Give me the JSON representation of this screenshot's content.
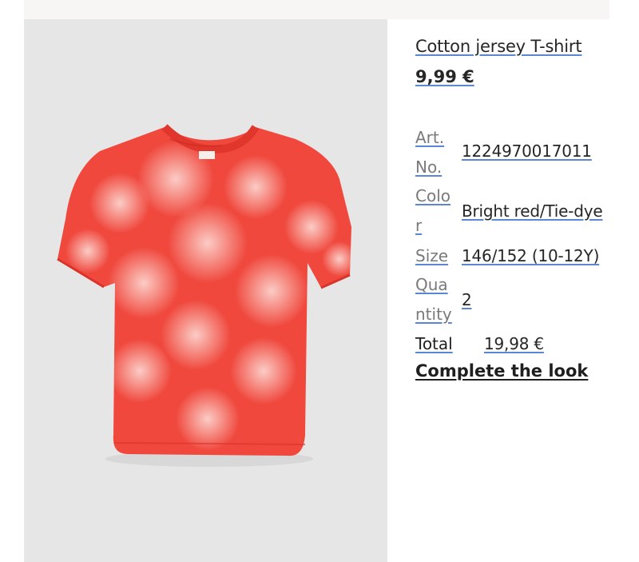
{
  "product": {
    "image_icon": "tie-dye-tshirt",
    "title": "Cotton jersey T-shirt",
    "price": "9,99 €"
  },
  "details": {
    "art_label_line1": "Art.",
    "art_label_line2": "No.",
    "art_value": "1224970017011",
    "color_label_line1": "Colo",
    "color_label_line2": "r",
    "color_value": "Bright red/Tie-dye",
    "size_label": "Size",
    "size_value": "146/152 (10-12Y)",
    "quantity_label_line1": "Qua",
    "quantity_label_line2": "ntity",
    "quantity_value": "2",
    "total_label": "Total",
    "total_value": "19,98 €"
  },
  "cta": {
    "complete_look": "Complete the look"
  },
  "colors": {
    "shirt_red": "#f0483d",
    "shirt_light": "#f7a8a0",
    "background": "#e6e6e6",
    "link_underline": "#5b86d6"
  }
}
